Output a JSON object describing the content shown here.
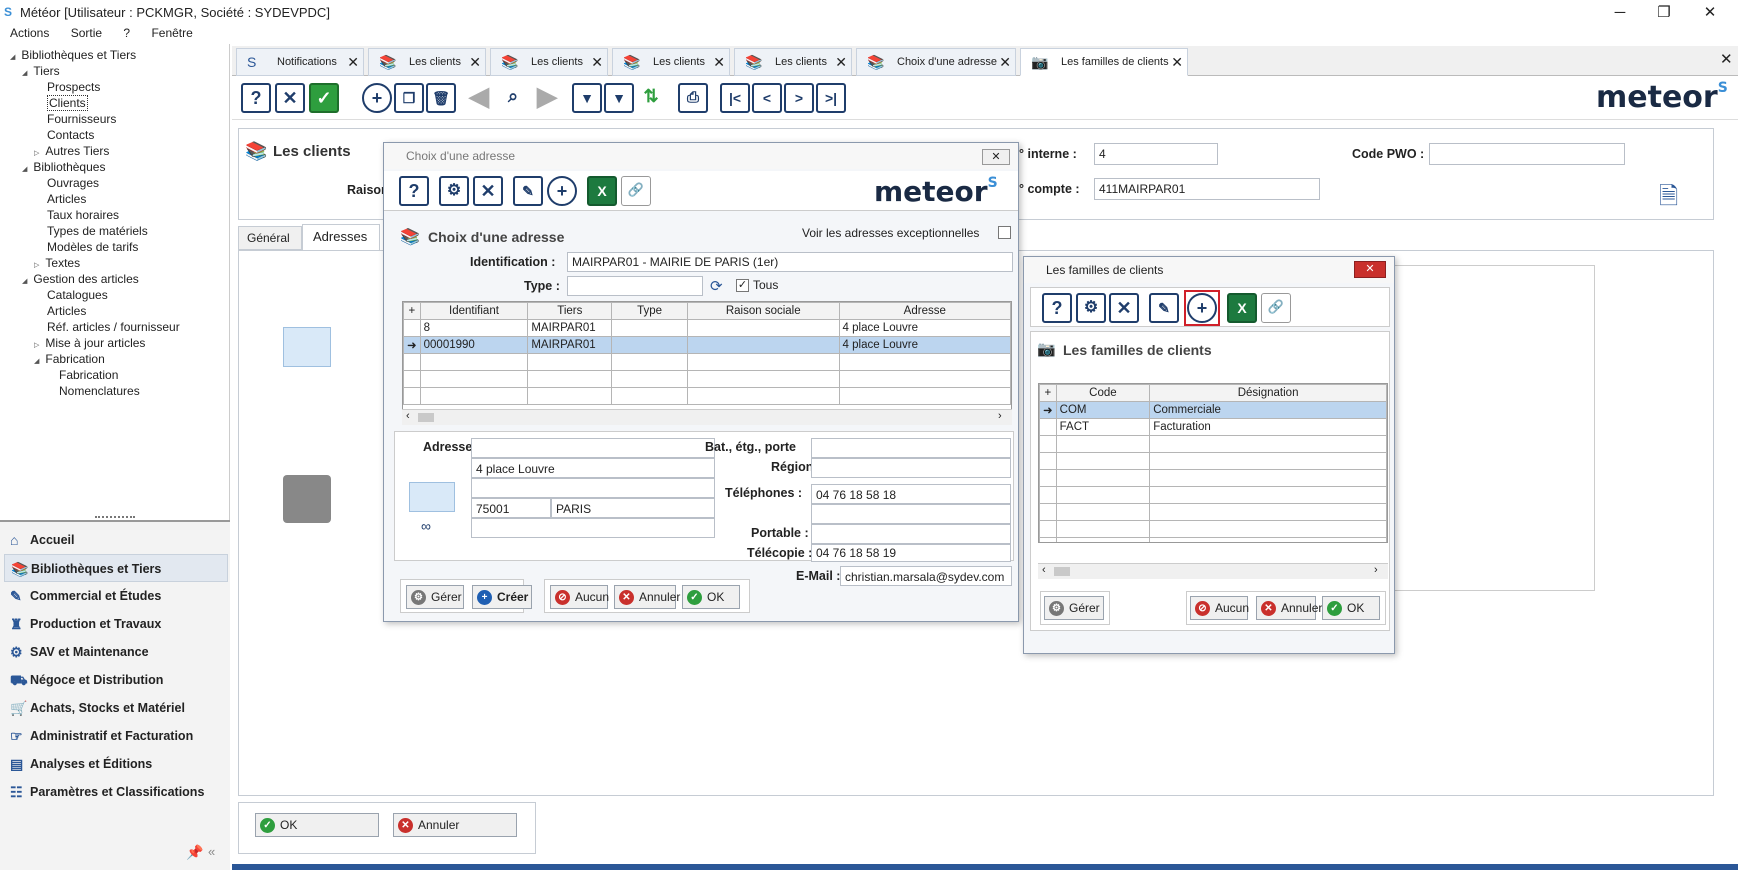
{
  "window": {
    "title": "Météor [Utilisateur : PCKMGR, Société : SYDEVPDC]"
  },
  "menu": [
    "Actions",
    "Sortie",
    "?",
    "Fenêtre"
  ],
  "tree": [
    {
      "label": "Bibliothèques et Tiers",
      "level": 0,
      "arrow": "◢"
    },
    {
      "label": "Tiers",
      "level": 1,
      "arrow": "◢"
    },
    {
      "label": "Prospects",
      "level": 2,
      "arrow": ""
    },
    {
      "label": "Clients",
      "level": 2,
      "arrow": ""
    },
    {
      "label": "Fournisseurs",
      "level": 2,
      "arrow": ""
    },
    {
      "label": "Contacts",
      "level": 2,
      "arrow": ""
    },
    {
      "label": "Autres Tiers",
      "level": 2,
      "arrow": "▷"
    },
    {
      "label": "Bibliothèques",
      "level": 1,
      "arrow": "◢"
    },
    {
      "label": "Ouvrages",
      "level": 2,
      "arrow": ""
    },
    {
      "label": "Articles",
      "level": 2,
      "arrow": ""
    },
    {
      "label": "Taux horaires",
      "level": 2,
      "arrow": ""
    },
    {
      "label": "Types de matériels",
      "level": 2,
      "arrow": ""
    },
    {
      "label": "Modèles de tarifs",
      "level": 2,
      "arrow": ""
    },
    {
      "label": "Textes",
      "level": 2,
      "arrow": "▷"
    },
    {
      "label": "Gestion des articles",
      "level": 1,
      "arrow": "◢"
    },
    {
      "label": "Catalogues",
      "level": 2,
      "arrow": ""
    },
    {
      "label": "Articles",
      "level": 2,
      "arrow": ""
    },
    {
      "label": "Réf. articles / fournisseur",
      "level": 2,
      "arrow": ""
    },
    {
      "label": "Mise à jour articles",
      "level": 2,
      "arrow": "▷"
    },
    {
      "label": "Fabrication",
      "level": 2,
      "arrow": "◢"
    },
    {
      "label": "Fabrication",
      "level": 3,
      "arrow": ""
    },
    {
      "label": "Nomenclatures",
      "level": 3,
      "arrow": ""
    }
  ],
  "nav": [
    "Accueil",
    "Bibliothèques et Tiers",
    "Commercial et Études",
    "Production et Travaux",
    "SAV et Maintenance",
    "Négoce et Distribution",
    "Achats, Stocks et Matériel",
    "Administratif et Facturation",
    "Analyses et Éditions",
    "Paramètres et Classifications"
  ],
  "tabs": [
    "Notifications",
    "Les clients",
    "Les clients",
    "Les clients",
    "Les clients",
    "Choix d'une adresse",
    "Les familles de clients"
  ],
  "logo": "meteor",
  "client": {
    "title": "Les clients",
    "raison_label": "Raison",
    "interne_label": "° interne :",
    "interne_value": "4",
    "compte_label": "° compte :",
    "compte_value": "411MAIRPAR01",
    "pwo_label": "Code PWO :",
    "pwo_value": "",
    "tab_general": "Général",
    "tab_adresses": "Adresses",
    "ok": "OK",
    "annuler": "Annuler"
  },
  "adresse_dialog": {
    "title": "Choix d'une adresse",
    "heading": "Choix d'une adresse",
    "exceptionnelles": "Voir les adresses exceptionnelles",
    "ident_label": "Identification :",
    "ident_value": "MAIRPAR01 - MAIRIE DE PARIS (1er)",
    "type_label": "Type :",
    "type_value": "",
    "tous": "Tous",
    "columns": [
      "Identifiant",
      "Tiers",
      "Type",
      "Raison sociale",
      "Adresse"
    ],
    "rows": [
      [
        "8",
        "MAIRPAR01",
        "",
        "",
        "4 place Louvre"
      ],
      [
        "00001990",
        "MAIRPAR01",
        "",
        "",
        "4 place Louvre"
      ]
    ],
    "adresse_label": "Adresse :",
    "addr_line1": "",
    "addr_line2": "4 place Louvre",
    "addr_line3": "",
    "cp": "75001",
    "ville": "PARIS",
    "addr_line5": "",
    "bat_label": "Bat., étg., porte",
    "bat_value": "",
    "region_label": "Région :",
    "region_value": "",
    "tel_label": "Téléphones :",
    "tel_value": "04 76 18 58 18",
    "tel2_value": "",
    "portable_label": "Portable :",
    "portable_value": "",
    "fax_label": "Télécopie :",
    "fax_value": "04 76 18 58 19",
    "email_label": "E-Mail :",
    "email_value": "christian.marsala@sydev.com",
    "buttons": {
      "gerer": "Gérer",
      "creer": "Créer",
      "aucun": "Aucun",
      "annuler": "Annuler",
      "ok": "OK"
    }
  },
  "familles_dialog": {
    "title": "Les familles de clients",
    "heading": "Les familles de clients",
    "columns": [
      "Code",
      "Désignation"
    ],
    "rows": [
      [
        "COM",
        "Commerciale"
      ],
      [
        "FACT",
        "Facturation"
      ]
    ],
    "buttons": {
      "gerer": "Gérer",
      "aucun": "Aucun",
      "annuler": "Annuler",
      "ok": "OK"
    }
  }
}
